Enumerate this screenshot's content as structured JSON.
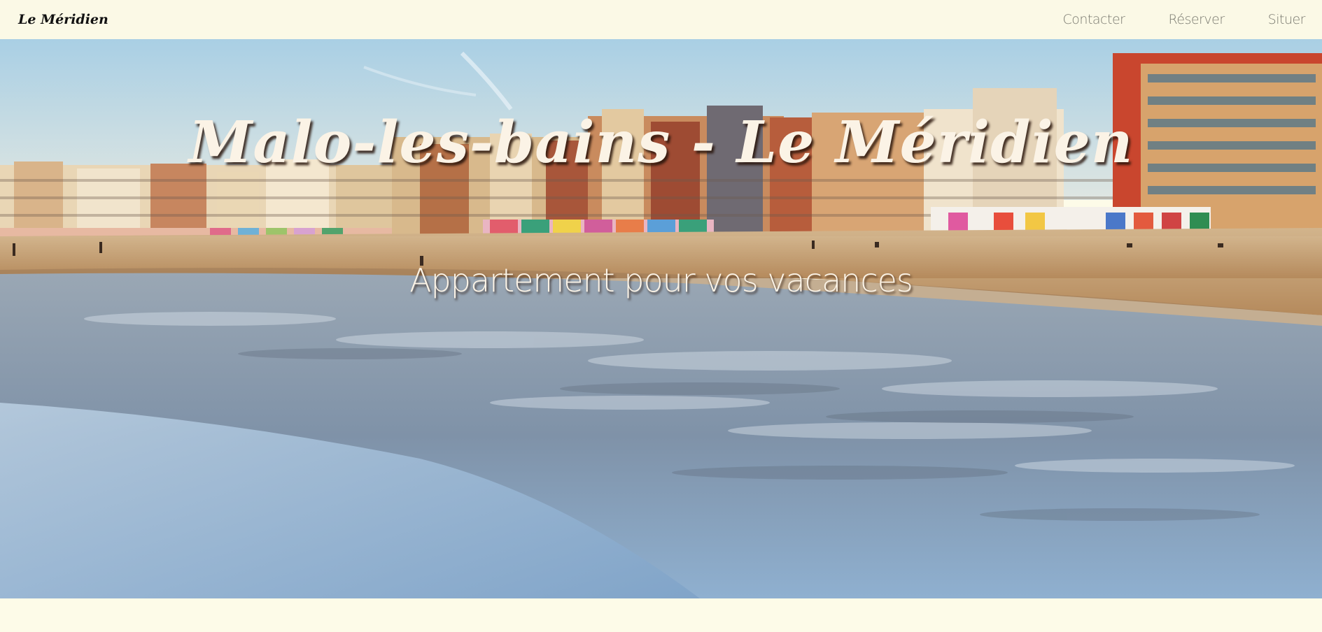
{
  "navbar": {
    "brand": "Le Méridien",
    "links": [
      {
        "label": "Contacter"
      },
      {
        "label": "Réserver"
      },
      {
        "label": "Situer"
      }
    ]
  },
  "hero": {
    "title": "Malo-les-bains - Le Méridien",
    "subtitle": "Appartement pour vos vacances",
    "image": "beach-promenade-photo"
  },
  "colors": {
    "navbar_bg": "#fbf9e6",
    "page_bg": "#fdfbe8",
    "hero_text": "#fbf3e6"
  }
}
